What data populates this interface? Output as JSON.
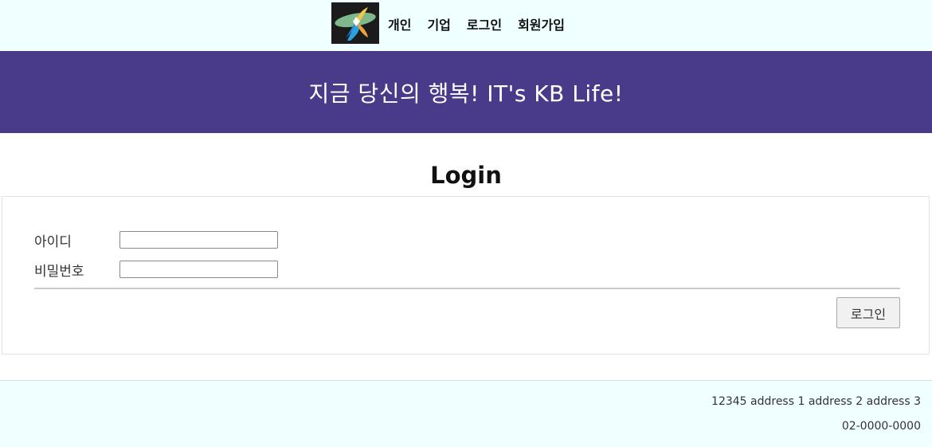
{
  "nav": {
    "logo_icon": "kb-star-logo-icon",
    "links": [
      "개인",
      "기업",
      "로그인",
      "회원가입"
    ]
  },
  "banner": {
    "text": "지금 당신의 행복! IT's KB Life!"
  },
  "login": {
    "title": "Login",
    "id_label": "아이디",
    "id_value": "",
    "password_label": "비밀번호",
    "password_value": "",
    "submit_label": "로그인"
  },
  "footer": {
    "address": "12345 address 1 address 2 address 3",
    "phone": "02-0000-0000"
  },
  "colors": {
    "banner_bg": "#4a3b8a",
    "nav_bg": "#f0ffff",
    "footer_bg": "#f0ffff"
  }
}
